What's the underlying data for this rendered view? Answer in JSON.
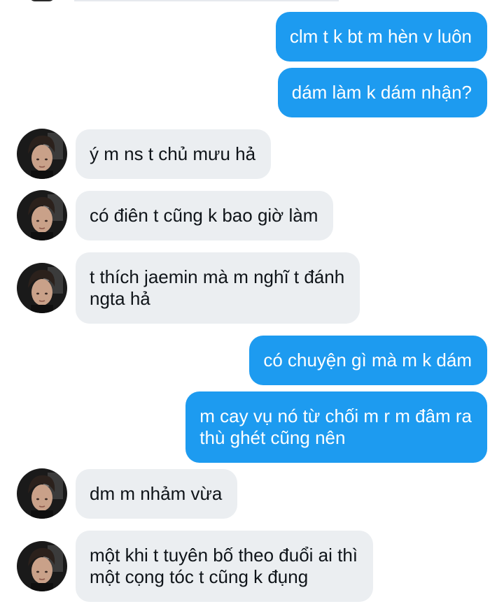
{
  "conversation": {
    "messages": [
      {
        "direction": "out",
        "text": "clm t k bt m hèn v luôn"
      },
      {
        "direction": "out",
        "text": "dám làm k dám nhận?"
      },
      {
        "direction": "in",
        "text": "ý m ns t chủ mưu hả"
      },
      {
        "direction": "in",
        "text": "có điên t cũng k bao giờ làm"
      },
      {
        "direction": "in",
        "text": "t thích jaemin mà m nghĩ t đánh\nngta hả"
      },
      {
        "direction": "out",
        "text": "có chuyện gì mà m k dám"
      },
      {
        "direction": "out",
        "text": "m cay vụ nó từ chối m r m đâm ra\nthù ghét cũng nên"
      },
      {
        "direction": "in",
        "text": "dm m nhảm vừa"
      },
      {
        "direction": "in",
        "text": "một khi t tuyên bố theo đuổi ai thì\nmột cọng tóc t cũng k đụng"
      }
    ]
  },
  "theme": {
    "sent_bubble": "#1d9bf0",
    "received_bubble": "#ebeef1",
    "sent_text": "#ffffff",
    "received_text": "#0f1419"
  }
}
